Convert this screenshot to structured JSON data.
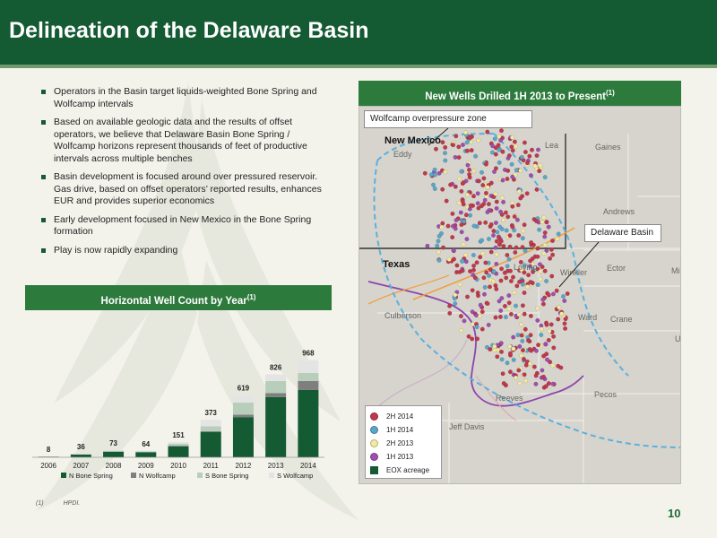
{
  "title": "Delineation of the Delaware Basin",
  "bullets": [
    "Operators in the Basin target liquids-weighted Bone Spring and Wolfcamp intervals",
    "Based on available geologic data and the results of offset operators, we believe that Delaware Basin Bone Spring / Wolfcamp horizons represent thousands of feet of productive intervals across multiple benches",
    "Basin development is focused around over pressured reservoir. Gas drive, based on offset operators’ reported results, enhances EUR and provides superior economics",
    "Early development focused in New Mexico in the Bone Spring formation",
    "Play is now rapidly expanding"
  ],
  "chart_banner": {
    "label": "Horizontal Well Count by Year",
    "sup": "(1)"
  },
  "map_banner": {
    "label": "New Wells Drilled 1H 2013 to Present",
    "sup": "(1)"
  },
  "footnote": {
    "number": "(1)",
    "text": "HPDI."
  },
  "page_number": "10",
  "colors": {
    "header": "#145a32",
    "banner": "#2d7a3d",
    "n_bone_spring": "#145a32",
    "n_wolfcamp": "#7f7f7f",
    "s_bone_spring": "#b7cfba",
    "s_wolfcamp": "#e4e4e4",
    "well_2h_2014": "#c0394b",
    "well_1h_2014": "#5aa6c8",
    "well_2h_2013": "#f3e9a0",
    "well_1h_2013": "#9c4fb0",
    "eox_acreage": "#145a32"
  },
  "chart_data": {
    "type": "bar",
    "stacked": true,
    "categories": [
      "2006",
      "2007",
      "2008",
      "2009",
      "2010",
      "2011",
      "2012",
      "2013",
      "2014"
    ],
    "totals": [
      8,
      36,
      73,
      64,
      151,
      373,
      619,
      826,
      968
    ],
    "series": [
      {
        "name": "N Bone Spring",
        "values": [
          6,
          27,
          54,
          50,
          110,
          250,
          400,
          600,
          670
        ]
      },
      {
        "name": "N Wolfcamp",
        "values": [
          0,
          1,
          3,
          2,
          5,
          10,
          25,
          40,
          90
        ]
      },
      {
        "name": "S Bone Spring",
        "values": [
          1,
          4,
          8,
          6,
          20,
          50,
          120,
          120,
          80
        ]
      },
      {
        "name": "S Wolfcamp",
        "values": [
          1,
          4,
          8,
          6,
          16,
          63,
          74,
          66,
          128
        ]
      }
    ],
    "legend_position": "bottom",
    "ylim": [
      0,
      1000
    ],
    "grid": false
  },
  "map": {
    "labels": {
      "new_mexico": "New Mexico",
      "texas": "Texas",
      "eddy": "Eddy",
      "lea": "Lea",
      "gaines": "Gaines",
      "andrews": "Andrews",
      "loving": "Loving",
      "winkler": "Winkler",
      "ector": "Ector",
      "culberson": "Culberson",
      "ward": "Ward",
      "crane": "Crane",
      "reeves": "Reeves",
      "pecos": "Pecos",
      "jeff_davis": "Jeff Davis",
      "mi": "Mi",
      "u": "U"
    },
    "callouts": {
      "wolfcamp": "Wolfcamp overpressure zone",
      "delaware": "Delaware Basin"
    },
    "legend": [
      {
        "label": "2H 2014",
        "color": "#c0394b",
        "shape": "circle"
      },
      {
        "label": "1H 2014",
        "color": "#5aa6c8",
        "shape": "circle"
      },
      {
        "label": "2H 2013",
        "color": "#f3e9a0",
        "shape": "circle"
      },
      {
        "label": "1H 2013",
        "color": "#9c4fb0",
        "shape": "circle"
      },
      {
        "label": "EOX acreage",
        "color": "#145a32",
        "shape": "square"
      }
    ]
  }
}
